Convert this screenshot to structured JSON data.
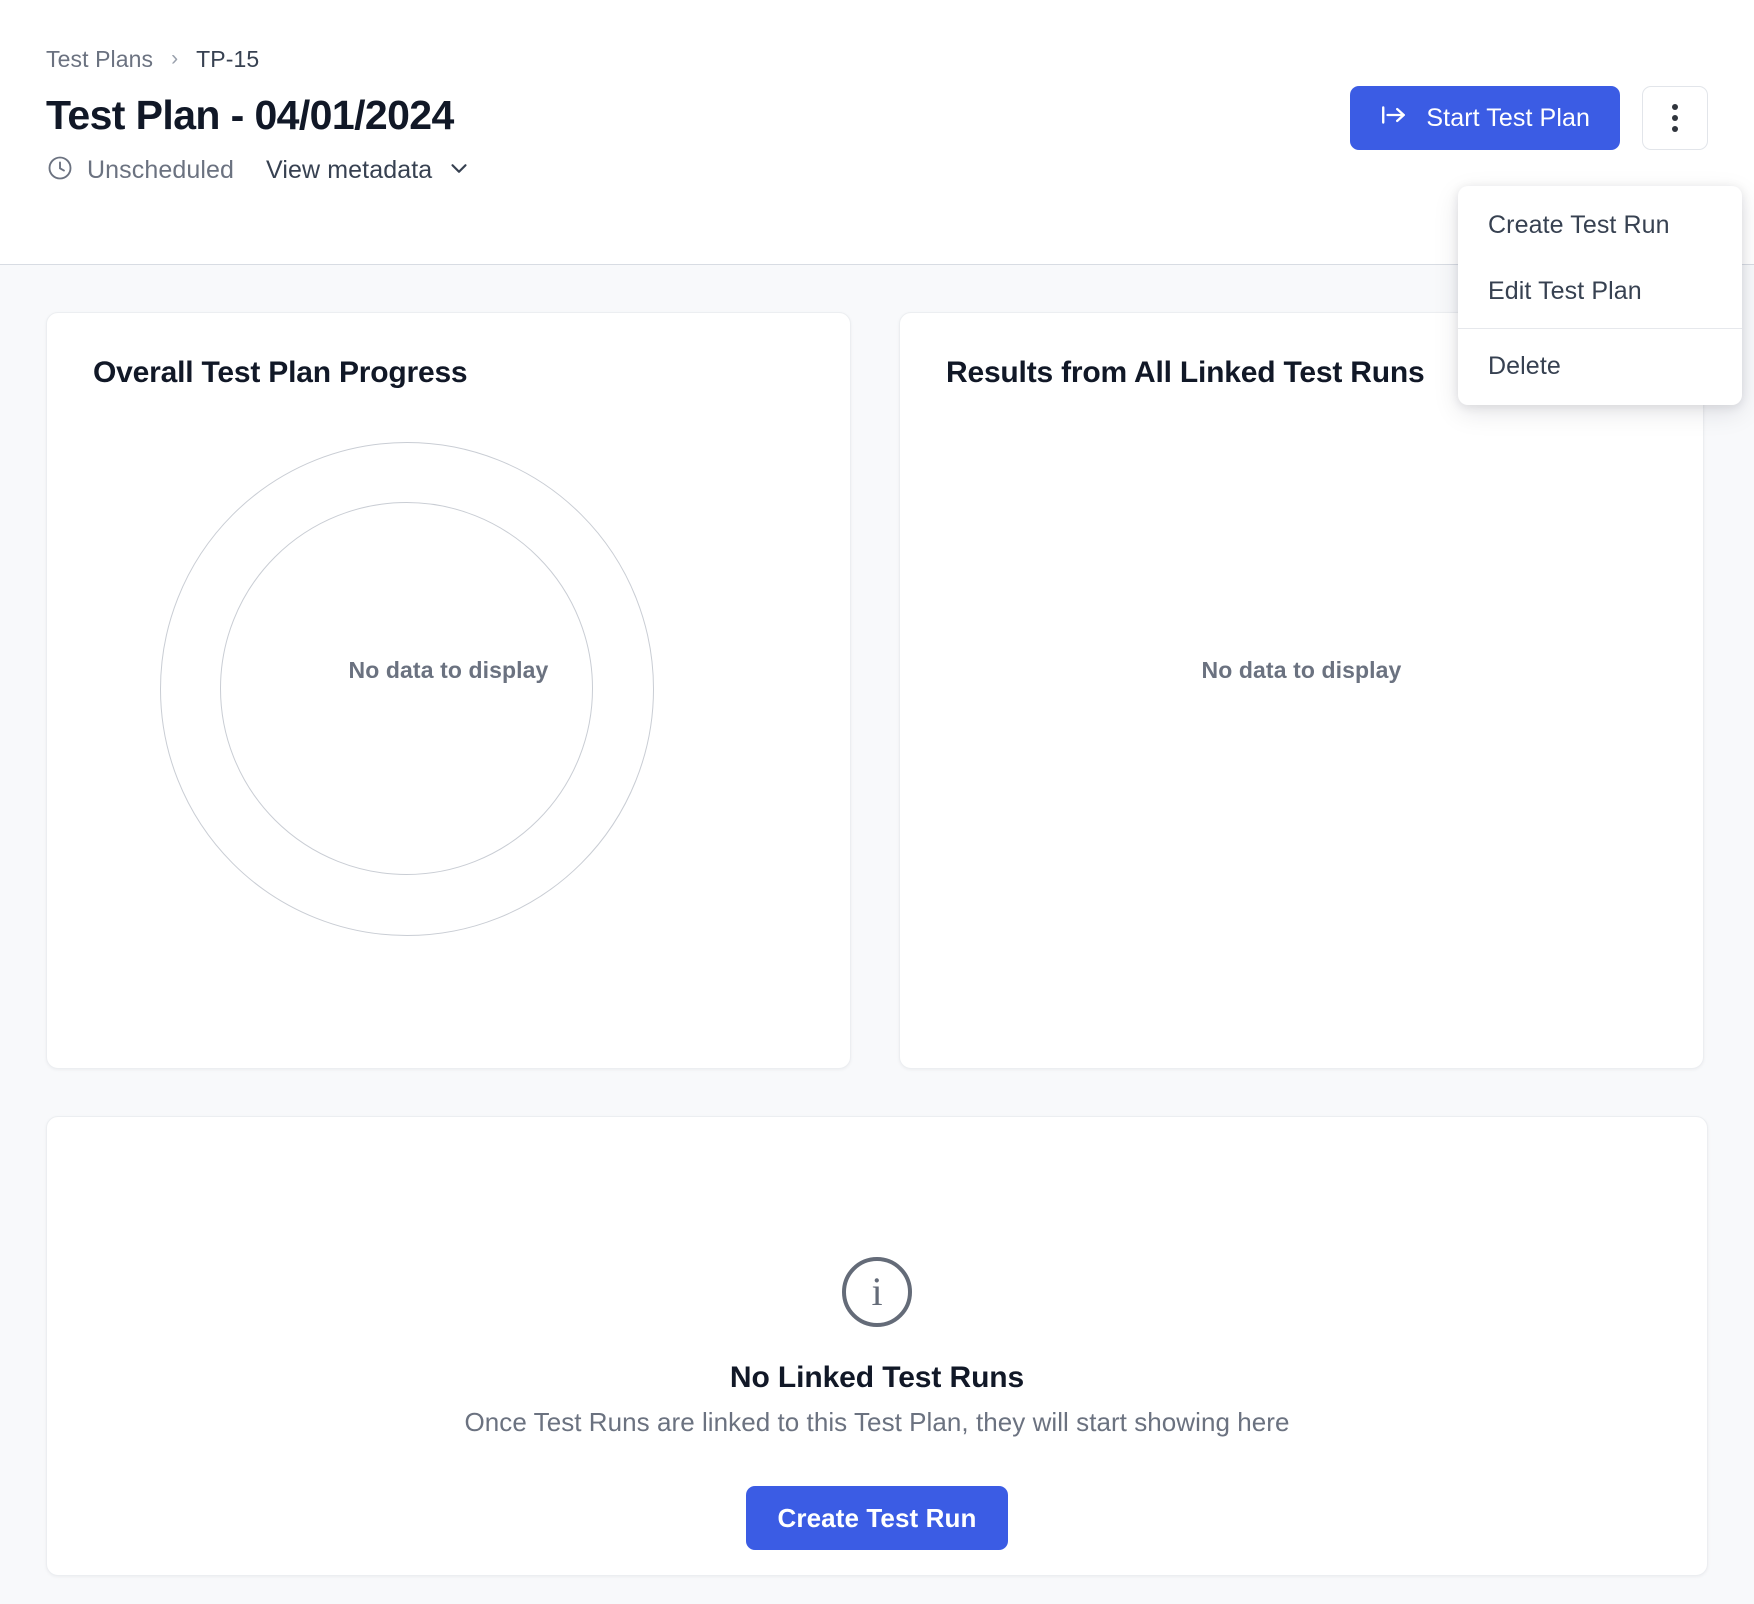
{
  "breadcrumb": {
    "parent": "Test Plans",
    "separator": "›",
    "current": "TP-15"
  },
  "header": {
    "title": "Test Plan - 04/01/2024",
    "status_label": "Unscheduled",
    "status_icon": "clock-icon",
    "metadata_toggle_label": "View metadata",
    "metadata_toggle_icon": "chevron-down-icon",
    "primary_button_label": "Start Test Plan",
    "primary_button_icon": "start-arrow-icon",
    "more_button_icon": "kebab-vertical-icon",
    "accent_color": "#3b5ce4"
  },
  "dropdown": {
    "open": true,
    "items": [
      {
        "label": "Create Test Run"
      },
      {
        "label": "Edit Test Plan"
      },
      {
        "label": "Delete"
      }
    ]
  },
  "cards": {
    "progress": {
      "title": "Overall Test Plan Progress",
      "empty_text": "No data to display"
    },
    "results": {
      "title": "Results from All Linked Test Runs",
      "empty_text": "No data to display"
    }
  },
  "linked_runs": {
    "icon": "info-circle-icon",
    "icon_glyph": "i",
    "title": "No Linked Test Runs",
    "subtitle": "Once Test Runs are linked to this Test Plan, they will start showing here",
    "button_label": "Create Test Run"
  },
  "chart_data": {
    "type": "pie",
    "title": "Overall Test Plan Progress",
    "categories": [],
    "values": [],
    "empty": true,
    "empty_message": "No data to display",
    "legend": "none",
    "grid": false
  }
}
